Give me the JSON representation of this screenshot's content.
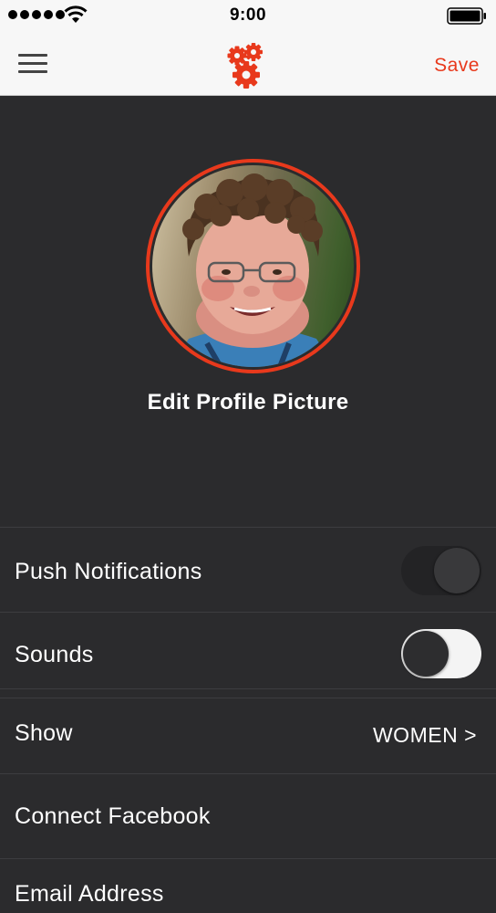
{
  "status_bar": {
    "time": "9:00",
    "signal_icon": "signal-dots-icon",
    "wifi_icon": "wifi-icon",
    "battery_icon": "battery-icon"
  },
  "nav": {
    "menu_icon": "hamburger-menu-icon",
    "logo_icon": "gears-icon",
    "save_label": "Save",
    "accent_color": "#e8391c"
  },
  "profile": {
    "edit_label": "Edit Profile Picture"
  },
  "settings": {
    "push_notifications": {
      "label": "Push Notifications",
      "on": true
    },
    "sounds": {
      "label": "Sounds",
      "on": false
    },
    "show": {
      "label": "Show",
      "value": "WOMEN >"
    },
    "connect_facebook": {
      "label": "Connect Facebook"
    },
    "email": {
      "label": "Email Address"
    }
  },
  "colors": {
    "background": "#2b2b2d",
    "header": "#f7f7f7",
    "accent": "#e8391c"
  }
}
